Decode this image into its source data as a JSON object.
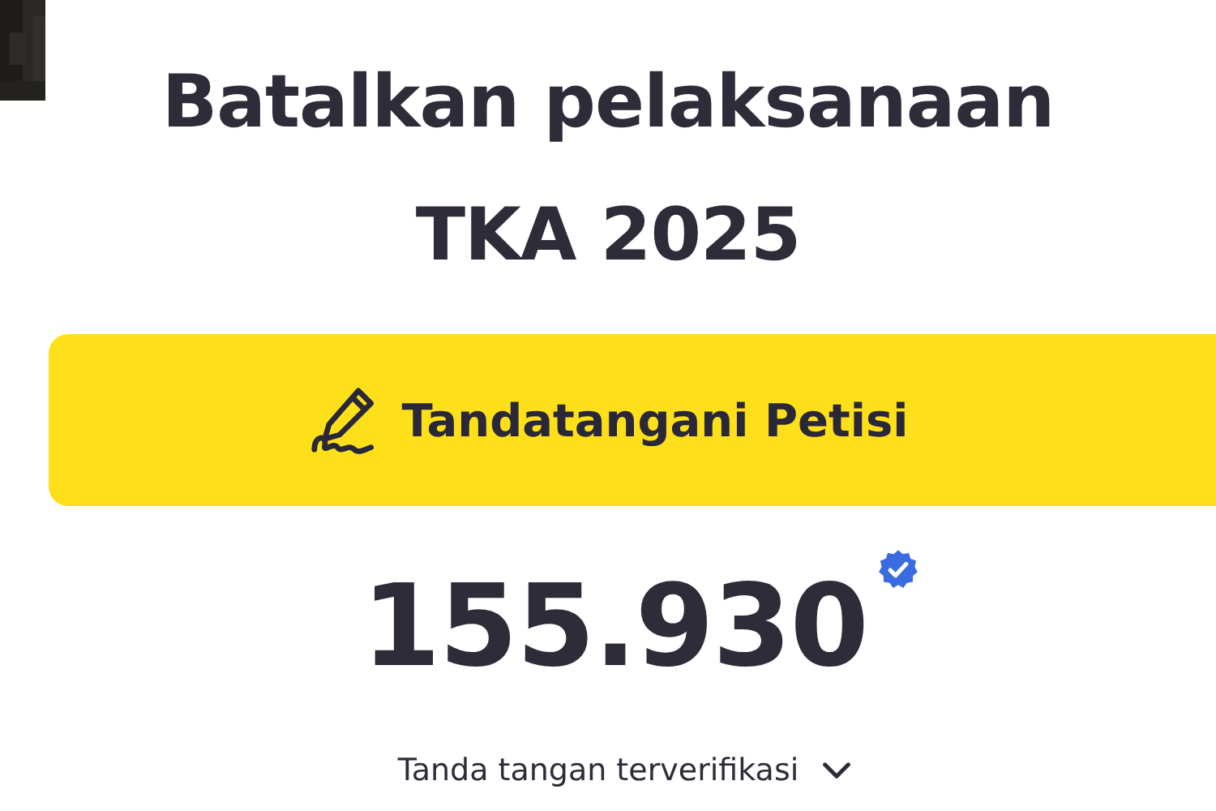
{
  "heading": "Batalkan pelaksanaan TKA 2025",
  "sign_button": {
    "label": "Tandatangani Petisi"
  },
  "signatures": {
    "count": "155.930",
    "verified": true,
    "label": "Tanda tangan terverifikasi"
  }
}
